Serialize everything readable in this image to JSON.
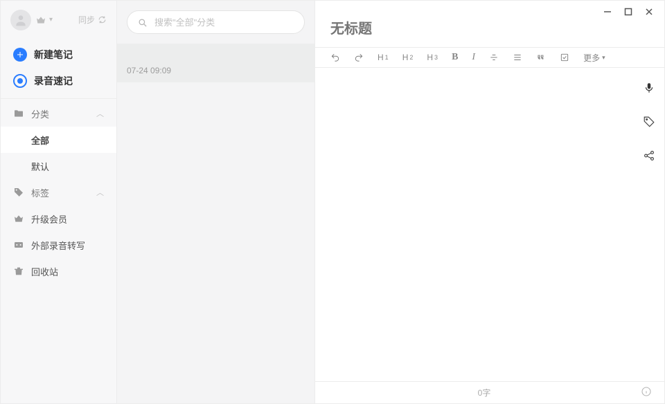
{
  "profile": {
    "sync_label": "同步"
  },
  "actions": {
    "new_note": "新建笔记",
    "voice_note": "录音速记"
  },
  "tree": {
    "category_header": "分类",
    "category_all": "全部",
    "category_default": "默认",
    "tags_header": "标签",
    "upgrade": "升级会员",
    "external_audio": "外部录音转写",
    "recycle": "回收站"
  },
  "search": {
    "placeholder": "搜索\"全部\"分类"
  },
  "notes": [
    {
      "time": "07-24 09:09"
    }
  ],
  "editor": {
    "title_placeholder": "无标题",
    "more_label": "更多",
    "word_count": "0字"
  },
  "toolbar": {
    "h1": "H",
    "h1s": "1",
    "h2": "H",
    "h2s": "2",
    "h3": "H",
    "h3s": "3",
    "bold": "B",
    "italic": "I"
  }
}
